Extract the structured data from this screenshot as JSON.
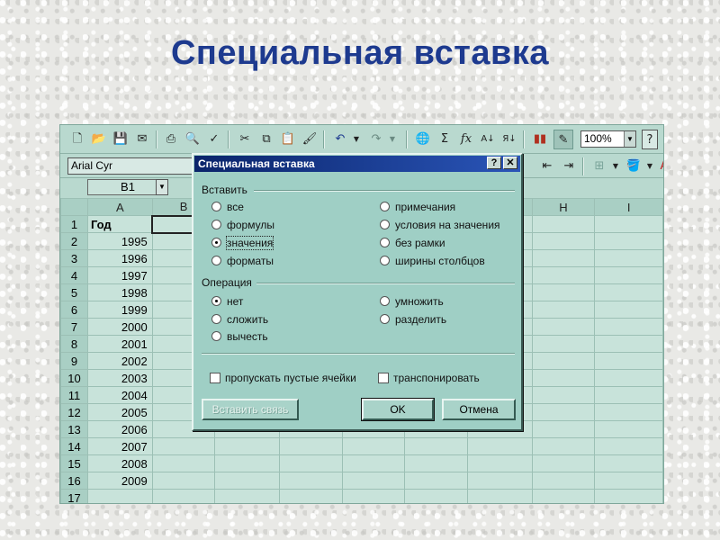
{
  "slide": {
    "title": "Специальная вставка"
  },
  "toolbar": {
    "zoom": "100%"
  },
  "format_toolbar": {
    "font": "Arial Cyr"
  },
  "formula_bar": {
    "name_box": "B1"
  },
  "sheet": {
    "columns": [
      "A",
      "B",
      "",
      "",
      "",
      "",
      "",
      "H",
      "I"
    ],
    "rows": [
      {
        "n": "1",
        "a": "Год"
      },
      {
        "n": "2",
        "a": "1995"
      },
      {
        "n": "3",
        "a": "1996"
      },
      {
        "n": "4",
        "a": "1997"
      },
      {
        "n": "5",
        "a": "1998"
      },
      {
        "n": "6",
        "a": "1999"
      },
      {
        "n": "7",
        "a": "2000"
      },
      {
        "n": "8",
        "a": "2001"
      },
      {
        "n": "9",
        "a": "2002"
      },
      {
        "n": "10",
        "a": "2003"
      },
      {
        "n": "11",
        "a": "2004"
      },
      {
        "n": "12",
        "a": "2005"
      },
      {
        "n": "13",
        "a": "2006"
      },
      {
        "n": "14",
        "a": "2007"
      },
      {
        "n": "15",
        "a": "2008"
      },
      {
        "n": "16",
        "a": "2009"
      },
      {
        "n": "17",
        "a": ""
      }
    ]
  },
  "dialog": {
    "title": "Специальная вставка",
    "help_button": "?",
    "close_button": "✕",
    "paste_group": "Вставить",
    "paste_options": [
      {
        "label": "все",
        "selected": false
      },
      {
        "label": "формулы",
        "selected": false
      },
      {
        "label": "значения",
        "selected": true
      },
      {
        "label": "форматы",
        "selected": false
      },
      {
        "label": "примечания",
        "selected": false
      },
      {
        "label": "условия на значения",
        "selected": false
      },
      {
        "label": "без рамки",
        "selected": false
      },
      {
        "label": "ширины столбцов",
        "selected": false
      }
    ],
    "operation_group": "Операция",
    "operation_options": [
      {
        "label": "нет",
        "selected": true
      },
      {
        "label": "сложить",
        "selected": false
      },
      {
        "label": "вычесть",
        "selected": false
      },
      {
        "label": "умножить",
        "selected": false
      },
      {
        "label": "разделить",
        "selected": false
      }
    ],
    "skip_blanks": "пропускать пустые ячейки",
    "transpose": "транспонировать",
    "paste_link_button": "Вставить связь",
    "ok_button": "OK",
    "cancel_button": "Отмена"
  }
}
